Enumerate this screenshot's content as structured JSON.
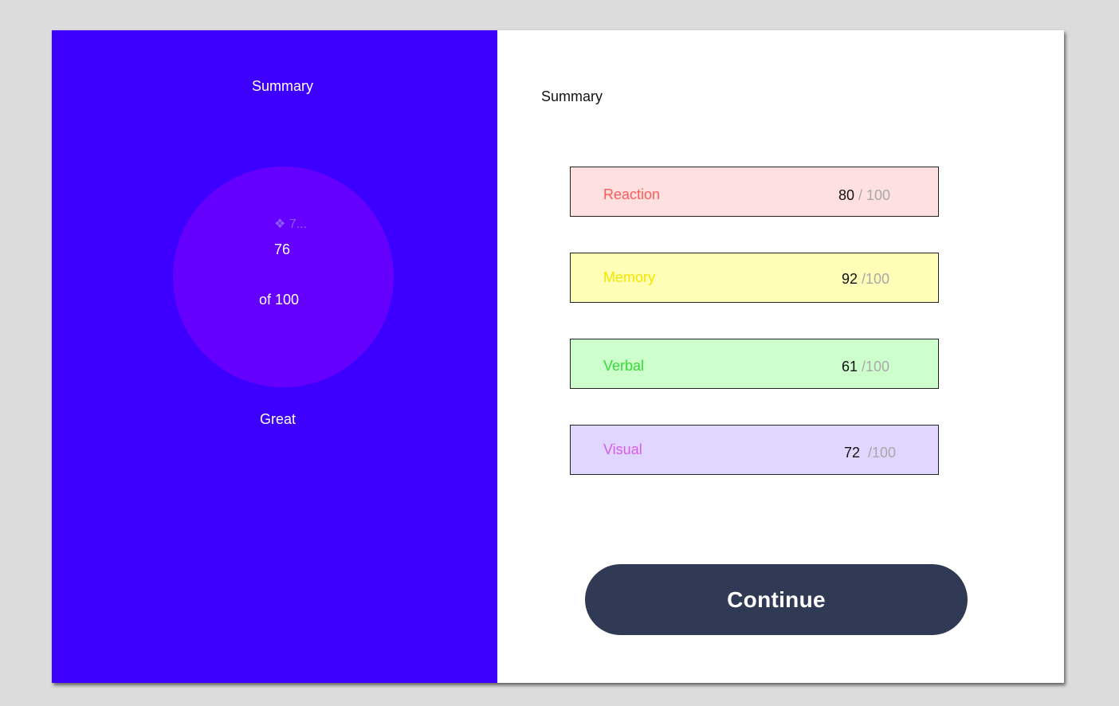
{
  "left": {
    "title": "Summary",
    "ghost_label": "❖ 7...",
    "score": "76",
    "score_total": "of 100",
    "rating": "Great"
  },
  "right": {
    "title": "Summary",
    "categories": [
      {
        "label": "Reaction",
        "score": "80",
        "max": " / 100",
        "bg": "#ffe0e0",
        "color": "#ff5a5a"
      },
      {
        "label": "Memory",
        "score": "92",
        "max": " /100",
        "bg": "#ffffb8",
        "color": "#f2e600"
      },
      {
        "label": "Verbal",
        "score": "61",
        "max": " /100",
        "bg": "#ccffcc",
        "color": "#33dd33"
      },
      {
        "label": "Visual",
        "score": "72",
        "max": "  /100",
        "bg": "#e0d6ff",
        "color": "#d65ce8"
      }
    ],
    "continue_label": "Continue"
  },
  "colors": {
    "panel_blue": "#3d00ff",
    "circle_purple": "#6500ff",
    "button_dark": "#313a54"
  }
}
